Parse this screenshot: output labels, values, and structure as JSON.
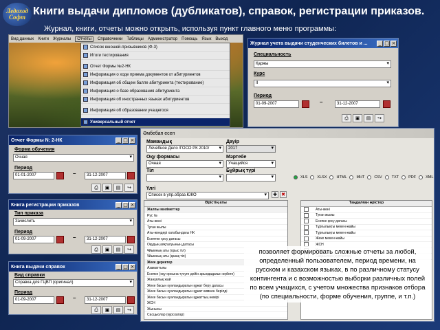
{
  "slide": {
    "title": "Книги выдачи дипломов (дубликатов), справок, регистрации приказов.",
    "subtitle": "Журнал, книги, отчеты можно открыть, используя пункт главного меню программы:",
    "logo_text": "Ледоход Софт",
    "caption": "позволяет формировать сложные отчеты за любой, определенный пользователем, период времени, на русском и казахском языках, в по различному статусу контингента и с возможностью выборки различных полей по всем учащихся, с учетом множества признаков отбора (по специальности, форме обучения, группе, и т.п.)"
  },
  "main_menu": {
    "menubar": [
      "Вид данных",
      "Книги",
      "Журналы",
      "Отчеты",
      "Справочники",
      "Таблицы",
      "Администратор",
      "Помощь",
      "Язык",
      "Выход"
    ],
    "items": [
      "Список юношей-призывников (Ф-3)",
      "Итоги тестирования",
      "Отчет Формы №2-НК",
      "Информация о ходе приема документов от абитуриентов",
      "Информация об общем балле абитуриента (тестирование)",
      "Информация о базе образования абитуриента",
      "Информация об иностранных языках абитуриентов",
      "Информация об образовании учащегося",
      "Универсальный отчет"
    ]
  },
  "journal_window": {
    "title": "Журнал учета выдачи студенческих билетов и ...",
    "specialty_label": "Специальность",
    "specialty_value": "Қаржы",
    "course_label": "Курс",
    "course_value": "II",
    "period_label": "Период",
    "date_from": "01-09-2007",
    "date_to": "31-12-2007"
  },
  "nk_window": {
    "title": "Отчет Формы N: 2-НК",
    "form_label": "Форма обучения",
    "form_value": "Очная",
    "period_label": "Период",
    "date_from": "01-01-2007",
    "date_to": "31-12-2007"
  },
  "orders_window": {
    "title": "Книга регистрации приказов",
    "type_label": "Тип приказа",
    "type_value": "Зачислить",
    "period_label": "Период",
    "date_from": "01-09-2007",
    "date_to": "31-12-2007"
  },
  "certs_window": {
    "title": "Книга выдачи справок",
    "type_label": "Вид справки",
    "type_value": "Справка для ГЦВП (оригинал)",
    "period_label": "Период",
    "date_from": "01-09-2007",
    "date_to": "31-12-2007"
  },
  "universal_window": {
    "title": "Әмбебап есеп",
    "specialty_label": "Мамандық",
    "specialty_value": "Лечебное Дело /ГОСО РК 2010/",
    "year_label": "Дауір",
    "year_value": "2017",
    "form_label": "Оқу формасы",
    "form_value": "Очная",
    "status_label": "Мәртебе",
    "status_value": "Учащийся",
    "lang_label": "Тіл",
    "group_label": "Бұйрық түрі",
    "template_label": "Үлгі",
    "template_value": "Список в упр.образ.ЮКО",
    "formats": [
      "XLS",
      "XLSX",
      "HTML",
      "MHT",
      "CSV",
      "TXT",
      "PDF",
      "XML"
    ],
    "fields_header": "Өрістің аты",
    "selected_header": "Таңдалған өрістер",
    "fields": [
      "Жалпы мәліметтер",
      "Рус №",
      "Аты-жөні",
      "Туған жылы",
      "Аты-жөндері хатабындағы НК",
      "Есептен қосу датасы",
      "Оқудың аяқталуының датасы",
      "Ұйымның аты (орыс тіл)",
      "Ұйымның аты (қазақ тіл)",
      "Жеке деректер",
      "Азаматтығы",
      "Есепке (оқу орнына түсуге дейін арындадағын жүйеге)",
      "Жанұялық жай",
      "Жеке басын куәландыратын құжат беру датасы",
      "Жеке басын куәландыратын құжат кимнен берілді",
      "Жеке басын куәландыратын құжаттың нөмірі",
      "ЖСН",
      "Жынысы",
      "Сасцыолар (курскатар)",
      "Телефон"
    ],
    "selected": [
      "Аты-жөні",
      "Туған жылы",
      "Есепке қосу датасы",
      "Тұрғылықты мекен-жайы",
      "Тұрғылықты мекен-жайы",
      "Жеке мекен-жайы",
      "ЖСН",
      "Ұлты",
      "Сақшылар (курсқатар)"
    ]
  }
}
